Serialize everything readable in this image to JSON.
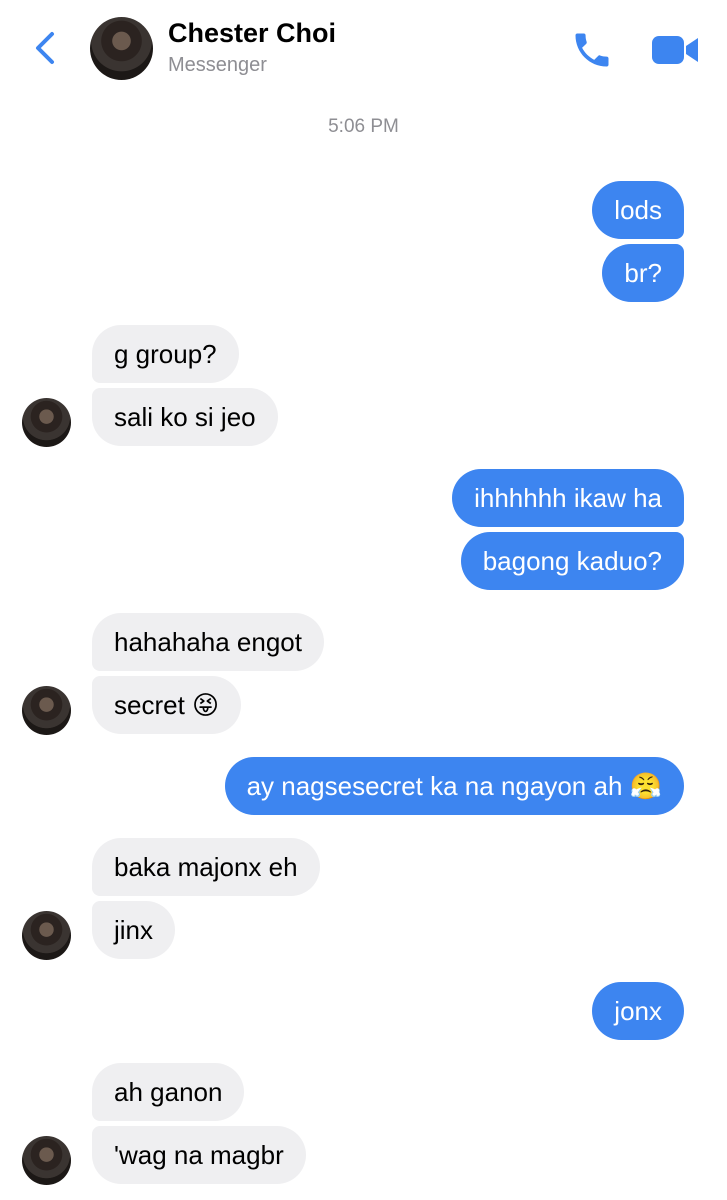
{
  "header": {
    "name": "Chester Choi",
    "subtitle": "Messenger",
    "icons": [
      "back-chevron-icon",
      "phone-icon",
      "video-camera-icon"
    ],
    "accent_color": "#3d85f0"
  },
  "timestamp": "5:06 PM",
  "messages": [
    {
      "from": "me",
      "text": "lods"
    },
    {
      "from": "me",
      "text": "br?"
    },
    {
      "from": "them",
      "text": "g group?"
    },
    {
      "from": "them",
      "text": "sali ko si jeo"
    },
    {
      "from": "me",
      "text": "ihhhhhh ikaw ha"
    },
    {
      "from": "me",
      "text": "bagong kaduo?"
    },
    {
      "from": "them",
      "text": "hahahaha engot"
    },
    {
      "from": "them",
      "text": "secret 😝"
    },
    {
      "from": "me",
      "text": "ay nagsesecret ka na ngayon ah 😤"
    },
    {
      "from": "them",
      "text": "baka majonx eh"
    },
    {
      "from": "them",
      "text": "jinx"
    },
    {
      "from": "me",
      "text": "jonx"
    },
    {
      "from": "them",
      "text": "ah ganon"
    },
    {
      "from": "them",
      "text": "'wag na magbr"
    }
  ],
  "colors": {
    "sent_bubble": "#3d85f0",
    "received_bubble": "#efeff1",
    "secondary_text": "#8e8e93"
  }
}
